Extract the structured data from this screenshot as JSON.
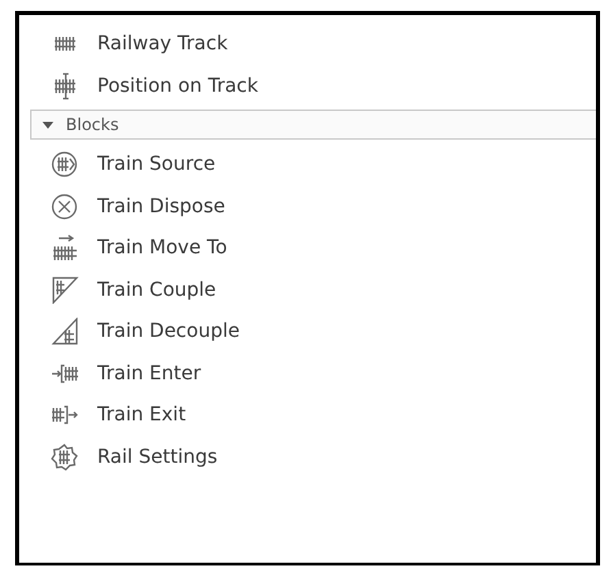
{
  "items": [
    {
      "label": "Railway Track",
      "kind": "track"
    },
    {
      "label": "Position on Track",
      "kind": "position"
    }
  ],
  "section": {
    "label": "Blocks",
    "expanded": true,
    "items": [
      {
        "label": "Train Source",
        "kind": "source"
      },
      {
        "label": "Train Dispose",
        "kind": "dispose"
      },
      {
        "label": "Train Move To",
        "kind": "move"
      },
      {
        "label": "Train Couple",
        "kind": "couple"
      },
      {
        "label": "Train Decouple",
        "kind": "decouple"
      },
      {
        "label": "Train Enter",
        "kind": "enter"
      },
      {
        "label": "Train Exit",
        "kind": "exit"
      },
      {
        "label": "Rail Settings",
        "kind": "settings"
      }
    ]
  }
}
